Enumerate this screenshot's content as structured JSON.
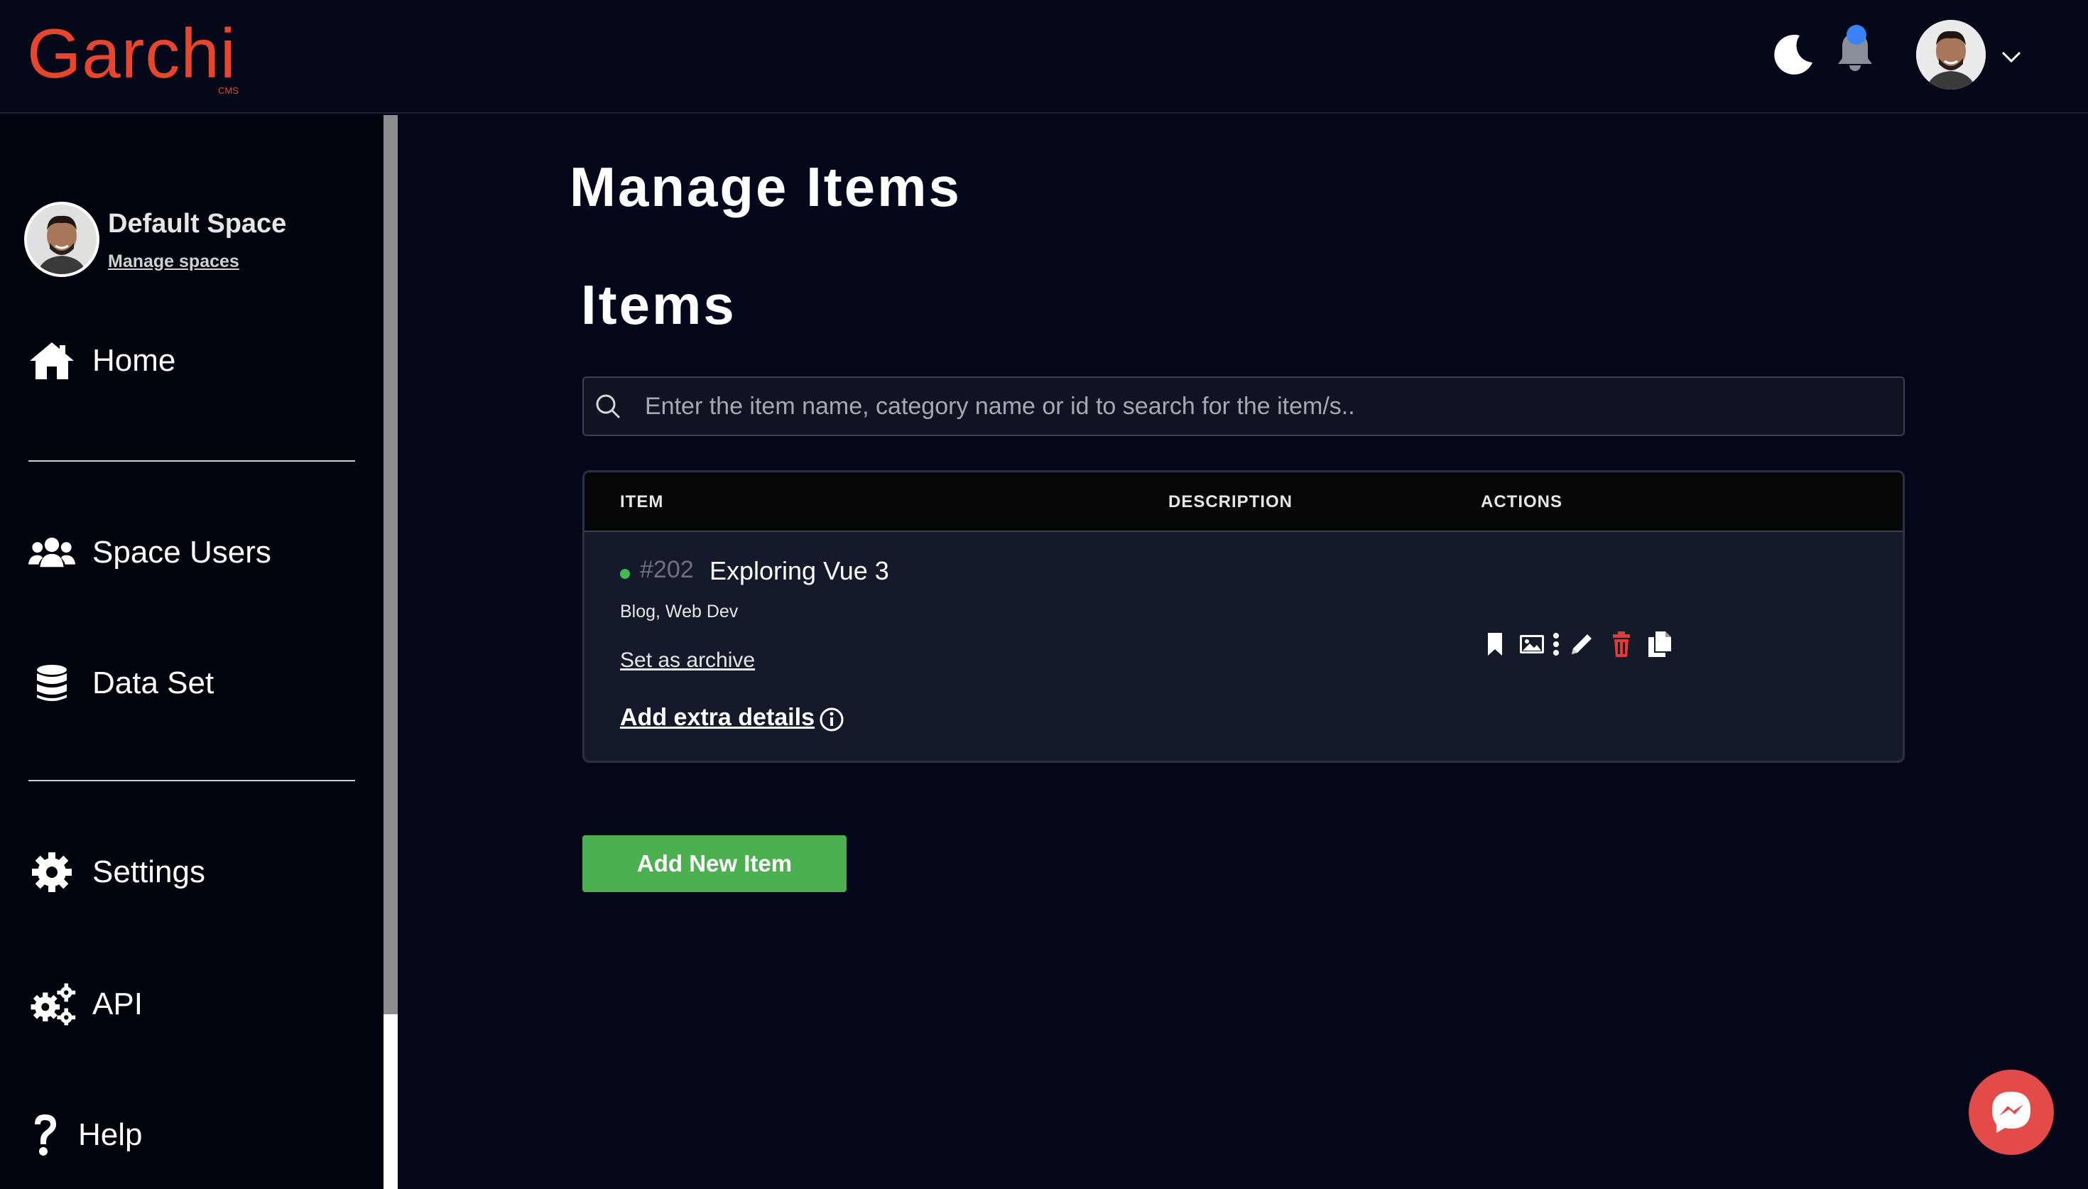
{
  "app": {
    "logo": "Garchi",
    "logo_sub": "CMS",
    "brand_color": "#e8452f"
  },
  "header": {
    "theme_icon": "moon-icon",
    "notification_icon": "bell-icon",
    "user_avatar": "avatar",
    "menu_icon": "chevron-down-icon"
  },
  "sidebar": {
    "space_name": "Default Space",
    "manage_spaces": "Manage spaces",
    "items": [
      {
        "label": "Home",
        "icon": "home-icon"
      },
      {
        "label": "Space Users",
        "icon": "users-icon"
      },
      {
        "label": "Data Set",
        "icon": "database-icon"
      },
      {
        "label": "Settings",
        "icon": "gear-icon"
      },
      {
        "label": "API",
        "icon": "gears-icon"
      },
      {
        "label": "Help",
        "icon": "question-icon"
      }
    ]
  },
  "main": {
    "page_title": "Manage Items",
    "section_title": "Items",
    "search": {
      "placeholder": "Enter the item name, category name or id to search for the item/s..",
      "value": ""
    },
    "table": {
      "columns": [
        "ITEM",
        "DESCRIPTION",
        "ACTIONS"
      ],
      "rows": [
        {
          "status_color": "#3fb950",
          "id": "#202",
          "name": "Exploring Vue 3",
          "categories": "Blog, Web Dev",
          "description": "",
          "archive_label": "Set as archive",
          "extra_label": "Add extra details",
          "actions": [
            "bookmark-icon",
            "image-icon",
            "more-vertical-icon",
            "edit-icon",
            "delete-icon",
            "copy-icon"
          ]
        }
      ]
    },
    "add_button": "Add New Item",
    "add_button_color": "#4caf50"
  },
  "chat": {
    "icon": "messenger-icon",
    "color": "#e34a4a"
  }
}
